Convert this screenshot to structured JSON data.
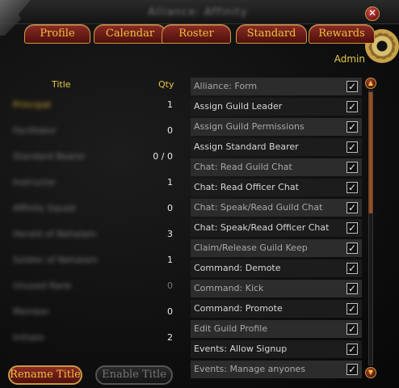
{
  "window": {
    "title": "Alliance: Affinity",
    "close_glyph": "✕"
  },
  "tabs": [
    {
      "label": "Profile"
    },
    {
      "label": "Calendar"
    },
    {
      "label": "Roster"
    },
    {
      "label": "Standard"
    },
    {
      "label": "Rewards"
    }
  ],
  "selected_rank": "Admin",
  "rank_list": {
    "title_header": "Title",
    "qty_header": "Qty",
    "rows": [
      {
        "name": "Principal",
        "qty": "1",
        "selected": true
      },
      {
        "name": "Facilitator",
        "qty": "0"
      },
      {
        "name": "Standard Bearer",
        "qty": "0 / 0"
      },
      {
        "name": "Instructor",
        "qty": "1"
      },
      {
        "name": "Affinity Squad",
        "qty": "0"
      },
      {
        "name": "Herald of Nehalam",
        "qty": "3"
      },
      {
        "name": "Soldier of Nehalam",
        "qty": "1"
      },
      {
        "name": "Unused Rank",
        "qty": "0",
        "dim": true
      },
      {
        "name": "Member",
        "qty": "0"
      },
      {
        "name": "Initiate",
        "qty": "2"
      }
    ]
  },
  "buttons": {
    "rename": "Rename Title",
    "enable": "Enable Title"
  },
  "permissions": [
    {
      "label": "Alliance: Form",
      "checked": true
    },
    {
      "label": "Assign Guild Leader",
      "checked": true
    },
    {
      "label": "Assign Guild Permissions",
      "checked": true
    },
    {
      "label": "Assign Standard Bearer",
      "checked": true
    },
    {
      "label": "Chat: Read Guild Chat",
      "checked": true
    },
    {
      "label": "Chat: Read Officer Chat",
      "checked": true
    },
    {
      "label": "Chat: Speak/Read Guild Chat",
      "checked": true
    },
    {
      "label": "Chat: Speak/Read Officer Chat",
      "checked": true
    },
    {
      "label": "Claim/Release Guild Keep",
      "checked": true
    },
    {
      "label": "Command: Demote",
      "checked": true
    },
    {
      "label": "Command: Kick",
      "checked": true
    },
    {
      "label": "Command: Promote",
      "checked": true
    },
    {
      "label": "Edit Guild Profile",
      "checked": true
    },
    {
      "label": "Events: Allow Signup",
      "checked": true
    },
    {
      "label": "Events: Manage anyones",
      "checked": true
    }
  ],
  "check_glyph": "✓",
  "scroll": {
    "up_glyph": "▲",
    "down_glyph": "▼"
  },
  "colors": {
    "accent_gold": "#f0c040",
    "tab_red": "#8a2b24"
  }
}
